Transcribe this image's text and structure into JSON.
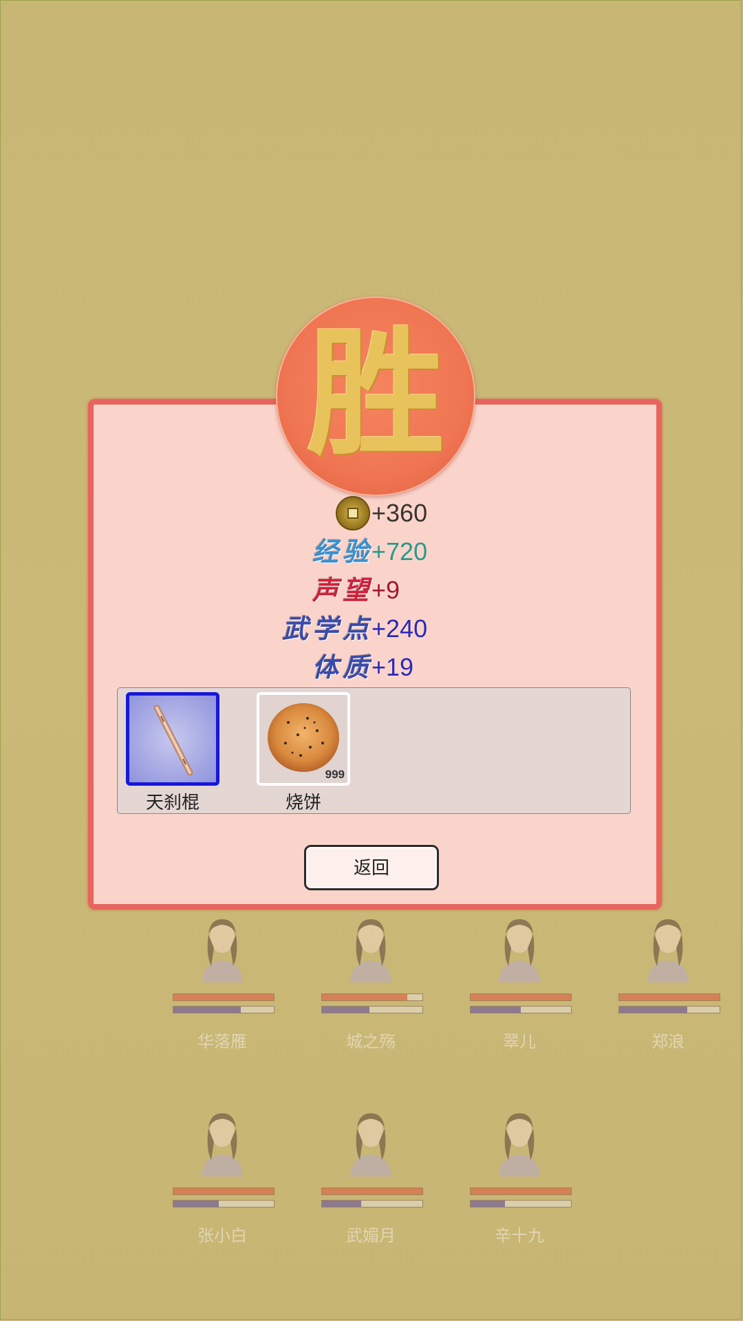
{
  "party": [
    {
      "name": "华落雁",
      "hp": 1.0,
      "mp": 0.67
    },
    {
      "name": "城之殇",
      "hp": 0.85,
      "mp": 0.47
    },
    {
      "name": "翠儿",
      "hp": 1.0,
      "mp": 0.5
    },
    {
      "name": "郑浪",
      "hp": 1.0,
      "mp": 0.68
    },
    {
      "name": "张小白",
      "hp": 1.0,
      "mp": 0.45
    },
    {
      "name": "武媚月",
      "hp": 1.0,
      "mp": 0.39
    },
    {
      "name": "辛十九",
      "hp": 1.0,
      "mp": 0.34
    }
  ],
  "result": {
    "badge_text": "胜",
    "rewards": {
      "coin": {
        "value": "+360",
        "icon": "coin-icon"
      },
      "exp": {
        "label": "经验",
        "value": "+720",
        "label_color": "#3a8fd0",
        "value_color": "#2a9a8a"
      },
      "fame": {
        "label": "声望",
        "value": "+9",
        "label_color": "#d0203a",
        "value_color": "#a01830"
      },
      "martial": {
        "label": "武学点",
        "value": "+240",
        "label_color": "#3a4aa8",
        "value_color": "#2a2ab8"
      },
      "physique": {
        "label": "体质",
        "value": "+19",
        "label_color": "#3a4aa8",
        "value_color": "#2a2ab8"
      }
    },
    "items": [
      {
        "name": "天刹棍",
        "icon": "staff-icon",
        "count": ""
      },
      {
        "name": "烧饼",
        "icon": "flatbread-icon",
        "count": "999"
      }
    ],
    "return_label": "返回"
  },
  "colors": {
    "background": "#c9b776",
    "dialog_bg": "#fad4cb",
    "dialog_border": "#e8645e",
    "badge": "#f07653",
    "selected_border": "#1818d8"
  }
}
